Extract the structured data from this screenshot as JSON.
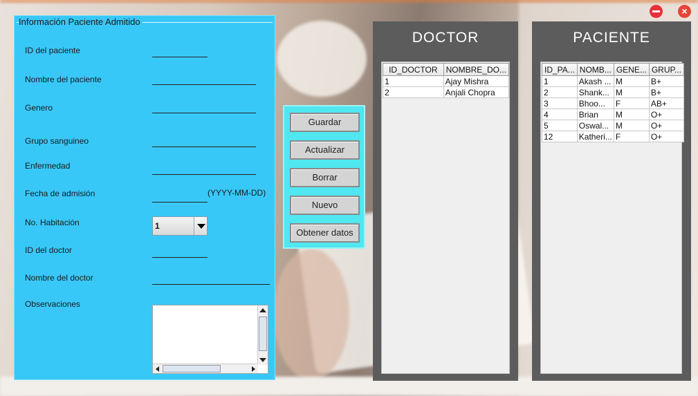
{
  "window": {
    "minimize_icon": "minimize-icon",
    "close_icon": "close-icon",
    "close_glyph": "×"
  },
  "patient_form": {
    "title": "Información Paciente Admitido",
    "labels": {
      "patient_id": "ID del paciente",
      "patient_name": "Nombre del paciente",
      "gender": "Genero",
      "blood_group": "Grupo sanguineo",
      "disease": "Enfermedad",
      "admission_date": "Fecha de admisión",
      "room_no": "No. Habitación",
      "doctor_id": "ID del doctor",
      "doctor_name": "Nombre del doctor",
      "observations": "Observaciones"
    },
    "date_hint": "(YYYY-MM-DD)",
    "room_selected": "1"
  },
  "actions": {
    "save": "Guardar",
    "update": "Actualizar",
    "delete": "Borrar",
    "new": "Nuevo",
    "get_data": "Obtener datos"
  },
  "doctor_table": {
    "title": "DOCTOR",
    "columns": [
      "ID_DOCTOR",
      "NOMBRE_DO..."
    ],
    "rows": [
      [
        "1",
        "Ajay Mishra"
      ],
      [
        "2",
        "Anjali Chopra"
      ]
    ]
  },
  "patient_table": {
    "title": "PACIENTE",
    "columns": [
      "ID_PA...",
      "NOMB...",
      "GENE...",
      "GRUP..."
    ],
    "rows": [
      [
        "1",
        "Akash ...",
        "M",
        "B+"
      ],
      [
        "2",
        "Shank...",
        "M",
        "B+"
      ],
      [
        "3",
        "Bhoo...",
        "F",
        "AB+"
      ],
      [
        "4",
        "Brian",
        "M",
        "O+"
      ],
      [
        "5",
        "Oswal...",
        "M",
        "O+"
      ],
      [
        "12",
        "Katheri...",
        "F",
        "O+"
      ]
    ]
  },
  "colors": {
    "form_panel": "#38c8f8",
    "button_panel": "#50e7f1",
    "table_panel": "#5c5c5c",
    "window_buttons": "#e8303a"
  }
}
